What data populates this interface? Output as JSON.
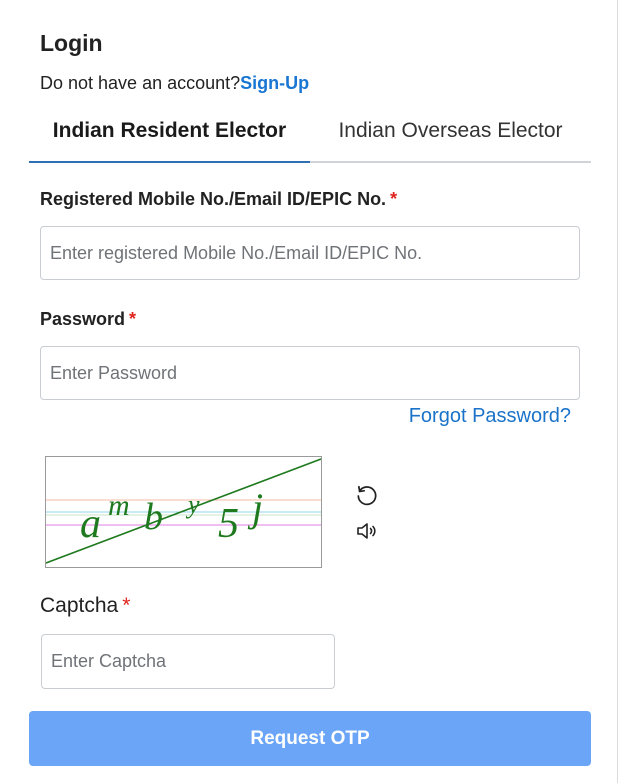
{
  "login": {
    "title": "Login",
    "signup_prompt": "Do not have an account?",
    "signup_link": "Sign-Up"
  },
  "tabs": [
    {
      "label": "Indian Resident Elector",
      "active": true
    },
    {
      "label": "Indian Overseas Elector",
      "active": false
    }
  ],
  "form": {
    "id_label": "Registered Mobile No./Email ID/EPIC No.",
    "id_placeholder": "Enter registered Mobile No./Email ID/EPIC No.",
    "id_value": "",
    "password_label": "Password",
    "password_placeholder": "Enter Password",
    "password_value": "",
    "required_mark": "*",
    "forgot_link": "Forgot Password?",
    "captcha_label": "Captcha",
    "captcha_placeholder": "Enter Captcha",
    "captcha_value": "",
    "captcha_text": "amby5j",
    "submit_label": "Request OTP"
  },
  "icons": {
    "refresh": "refresh-icon",
    "audio": "speaker-icon"
  },
  "colors": {
    "link": "#1976d2",
    "required": "#e0241b",
    "active_tab_underline": "#2f6fb3",
    "button": "#6aa5f7",
    "captcha_text": "#1f7a1f"
  }
}
